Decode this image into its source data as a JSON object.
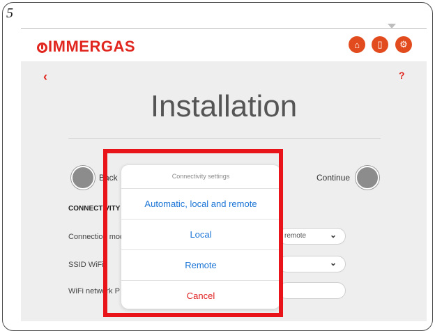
{
  "step_number": "5",
  "brand": {
    "name": "IMMERGAS",
    "color": "#e0261e"
  },
  "header_icons": [
    {
      "name": "home-icon",
      "glyph": "⌂"
    },
    {
      "name": "device-icon",
      "glyph": "▯"
    },
    {
      "name": "settings-icon",
      "glyph": "⚙"
    }
  ],
  "nav": {
    "back_glyph": "‹",
    "help": "?"
  },
  "page": {
    "title": "Installation",
    "back_label": "Back",
    "continue_label": "Continue",
    "section_title": "CONNECTIVITY",
    "rows": [
      {
        "label": "Connection mode",
        "value": "remote"
      },
      {
        "label": "SSID WiFi",
        "value": ""
      },
      {
        "label": "WiFi network P",
        "value": ""
      }
    ]
  },
  "action_sheet": {
    "title": "Connectivity settings",
    "options": [
      "Automatic, local and remote",
      "Local",
      "Remote"
    ],
    "cancel": "Cancel"
  },
  "colors": {
    "accent": "#e24b1d",
    "ios_blue": "#1a74d6",
    "cancel_red": "#e02020",
    "highlight": "#e8141a"
  }
}
